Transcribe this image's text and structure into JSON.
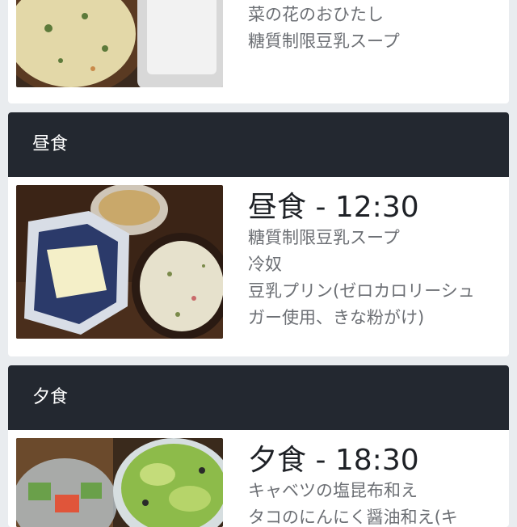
{
  "colors": {
    "page_bg": "#e9ecef",
    "header_bg": "#232830",
    "title_text": "#1e2126",
    "dish_text": "#6c6f74"
  },
  "breakfast": {
    "dishes": [
      "菜の花のおひたし",
      "糖質制限豆乳スープ"
    ],
    "photo_icon": "meal-photo"
  },
  "lunch": {
    "header": "昼食",
    "title": "昼食 - 12:30",
    "dishes": [
      "糖質制限豆乳スープ",
      "冷奴",
      "豆乳プリン(ゼロカロリーシュガー使用、きな粉がけ)"
    ],
    "photo_icon": "meal-photo"
  },
  "dinner": {
    "header": "夕食",
    "title": "夕食 - 18:30",
    "dishes": [
      "キャベツの塩昆布和え",
      "タコのにんにく醤油和え(キ"
    ],
    "photo_icon": "meal-photo"
  }
}
